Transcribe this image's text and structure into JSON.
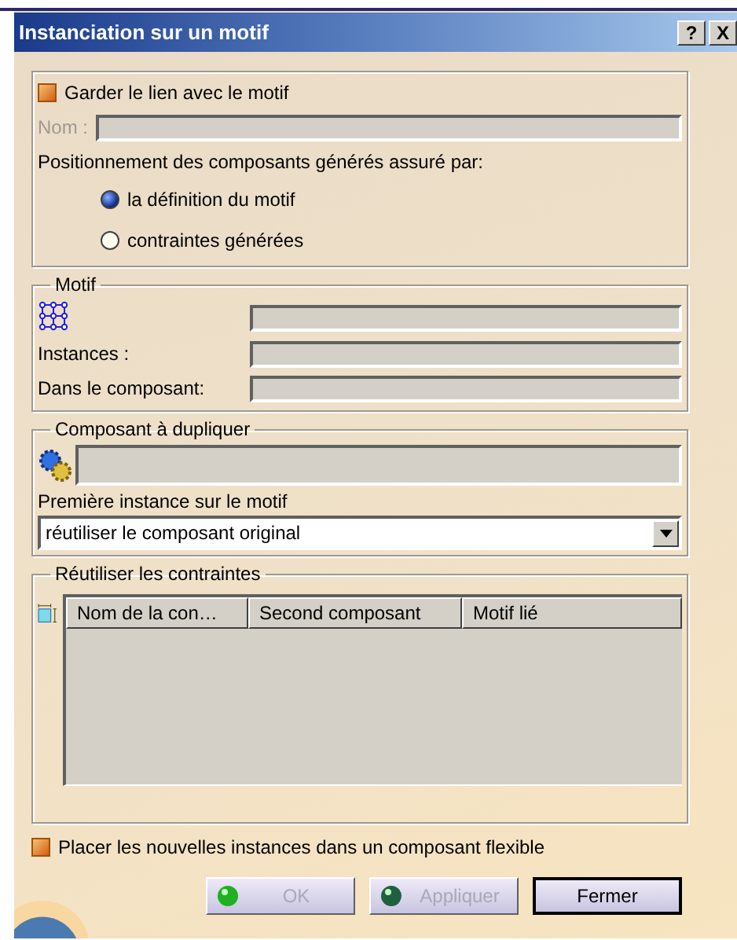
{
  "window": {
    "title": "Instanciation sur un motif",
    "help_button": "?",
    "close_button": "X"
  },
  "link_group": {
    "keep_link": {
      "label": "Garder le lien avec le motif",
      "checked": true
    },
    "name_field": {
      "label": "Nom :",
      "disabled": true
    },
    "positioning_label": "Positionnement des composants générés assuré par:",
    "options": [
      {
        "label": "la définition du motif",
        "selected": true
      },
      {
        "label": "contraintes générées",
        "selected": false
      }
    ]
  },
  "motif_group": {
    "legend": "Motif",
    "instances_label": "Instances :",
    "component_label": "Dans le composant:"
  },
  "duplicate_group": {
    "legend": "Composant à dupliquer",
    "first_instance_label": "Première instance sur le motif",
    "first_instance_value": "réutiliser le composant original"
  },
  "constraints_group": {
    "legend": "Réutiliser les contraintes",
    "columns": [
      "Nom de la con…",
      "Second composant",
      "Motif lié"
    ]
  },
  "flexible": {
    "label": "Placer les nouvelles instances dans un composant flexible",
    "checked": true
  },
  "buttons": [
    {
      "label": "OK",
      "kind": "ok",
      "disabled": true
    },
    {
      "label": "Appliquer",
      "kind": "apply",
      "disabled": true
    },
    {
      "label": "Fermer",
      "kind": "close",
      "disabled": false
    }
  ]
}
